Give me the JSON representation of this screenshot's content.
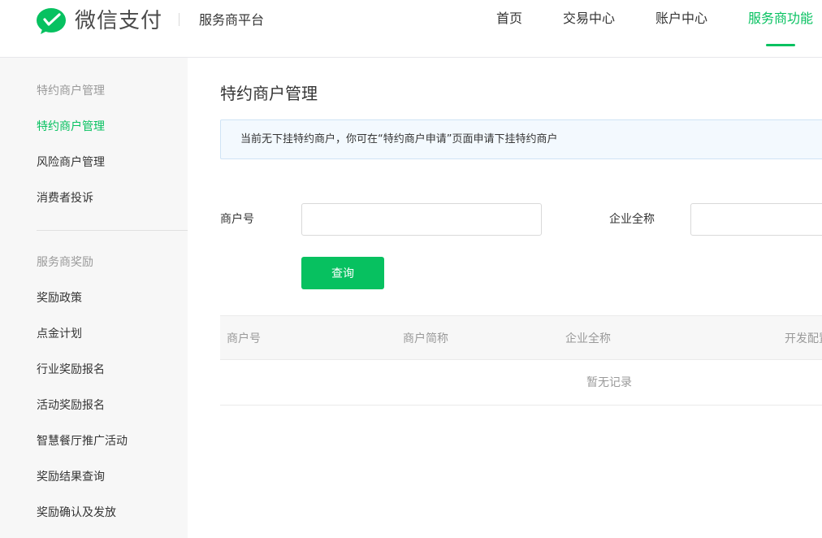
{
  "header": {
    "logo_text": "微信支付",
    "platform_name": "服务商平台",
    "brand_color": "#07c160",
    "nav": [
      {
        "label": "首页",
        "active": false
      },
      {
        "label": "交易中心",
        "active": false
      },
      {
        "label": "账户中心",
        "active": false
      },
      {
        "label": "服务商功能",
        "active": true
      }
    ]
  },
  "sidebar": {
    "groups": [
      {
        "title": "特约商户管理",
        "items": [
          {
            "label": "特约商户管理",
            "active": true
          },
          {
            "label": "风险商户管理",
            "active": false
          },
          {
            "label": "消费者投诉",
            "active": false
          }
        ]
      },
      {
        "title": "服务商奖励",
        "items": [
          {
            "label": "奖励政策",
            "active": false
          },
          {
            "label": "点金计划",
            "active": false
          },
          {
            "label": "行业奖励报名",
            "active": false
          },
          {
            "label": "活动奖励报名",
            "active": false
          },
          {
            "label": "智慧餐厅推广活动",
            "active": false
          },
          {
            "label": "奖励结果查询",
            "active": false
          },
          {
            "label": "奖励确认及发放",
            "active": false
          }
        ]
      }
    ]
  },
  "main": {
    "title": "特约商户管理",
    "notice": "当前无下挂特约商户，你可在“特约商户申请”页面申请下挂特约商户",
    "form": {
      "merchant_id_label": "商户号",
      "merchant_id_value": "",
      "company_name_label": "企业全称",
      "company_name_value": "",
      "query_button": "查询"
    },
    "table": {
      "columns": [
        "商户号",
        "商户简称",
        "企业全称",
        "开发配置"
      ],
      "empty_text": "暂无记录"
    }
  }
}
